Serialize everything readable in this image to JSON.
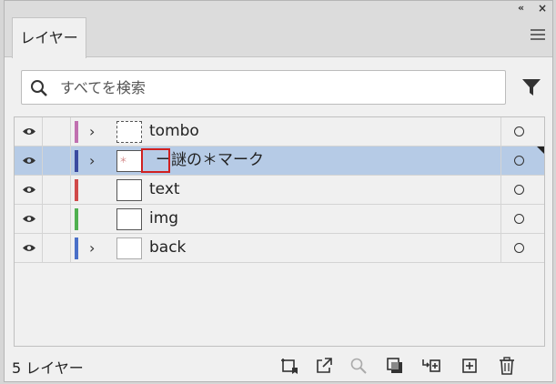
{
  "panel": {
    "tab_label": "レイヤー",
    "collapse_glyph": "«",
    "close_glyph": "×"
  },
  "search": {
    "placeholder": "すべてを検索",
    "value": ""
  },
  "layers": [
    {
      "name": "tombo",
      "color": "#c070b0",
      "expandable": true,
      "selected": false
    },
    {
      "name": "ー謎の＊マーク",
      "color": "#3a4aa0",
      "expandable": true,
      "selected": true,
      "highlight_text": "＊"
    },
    {
      "name": "text",
      "color": "#d04a4a",
      "expandable": false,
      "selected": false
    },
    {
      "name": "img",
      "color": "#50b050",
      "expandable": false,
      "selected": false
    },
    {
      "name": "back",
      "color": "#4a70c8",
      "expandable": true,
      "selected": false
    }
  ],
  "footer": {
    "layer_count": "5 レイヤー"
  },
  "colors": {
    "selection": "#b6cbe6",
    "highlight": "#d02020"
  }
}
